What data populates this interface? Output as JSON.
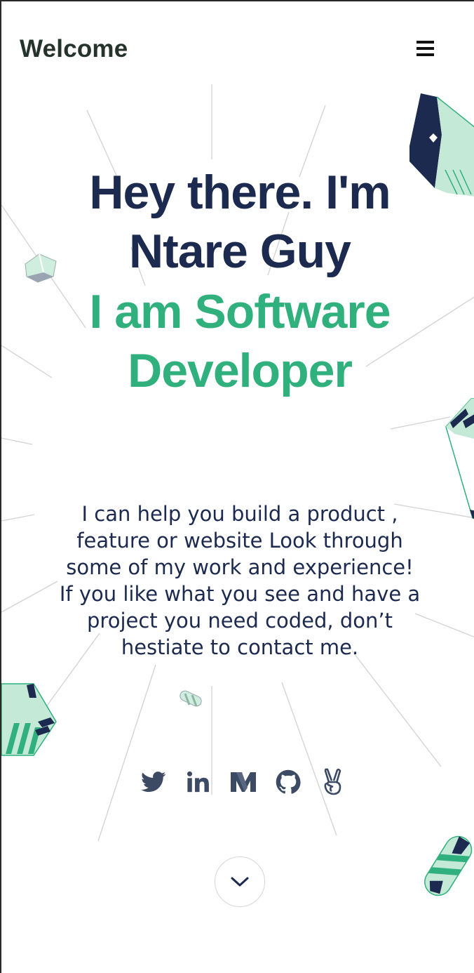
{
  "header": {
    "title": "Welcome",
    "menu_icon": "hamburger-menu-icon"
  },
  "hero": {
    "line1": "Hey there. I'm",
    "line2": "Ntare Guy",
    "line3": "I am Software",
    "line4": "Developer"
  },
  "bio": {
    "text": "I can help you build a product , feature or website Look through some of my work and experience! If you like what you see and have a project you need coded, don’t hestiate to contact me."
  },
  "socials": [
    {
      "icon": "twitter-icon"
    },
    {
      "icon": "linkedin-icon"
    },
    {
      "icon": "medium-icon"
    },
    {
      "icon": "github-icon"
    },
    {
      "icon": "angellist-icon"
    }
  ],
  "scroll": {
    "icon": "chevron-down-icon"
  },
  "colors": {
    "navy": "#1b2a4e",
    "green": "#2fb07c",
    "mint": "#c4ead7",
    "header_text": "#24332c",
    "icon_gray": "#3d4a63"
  }
}
